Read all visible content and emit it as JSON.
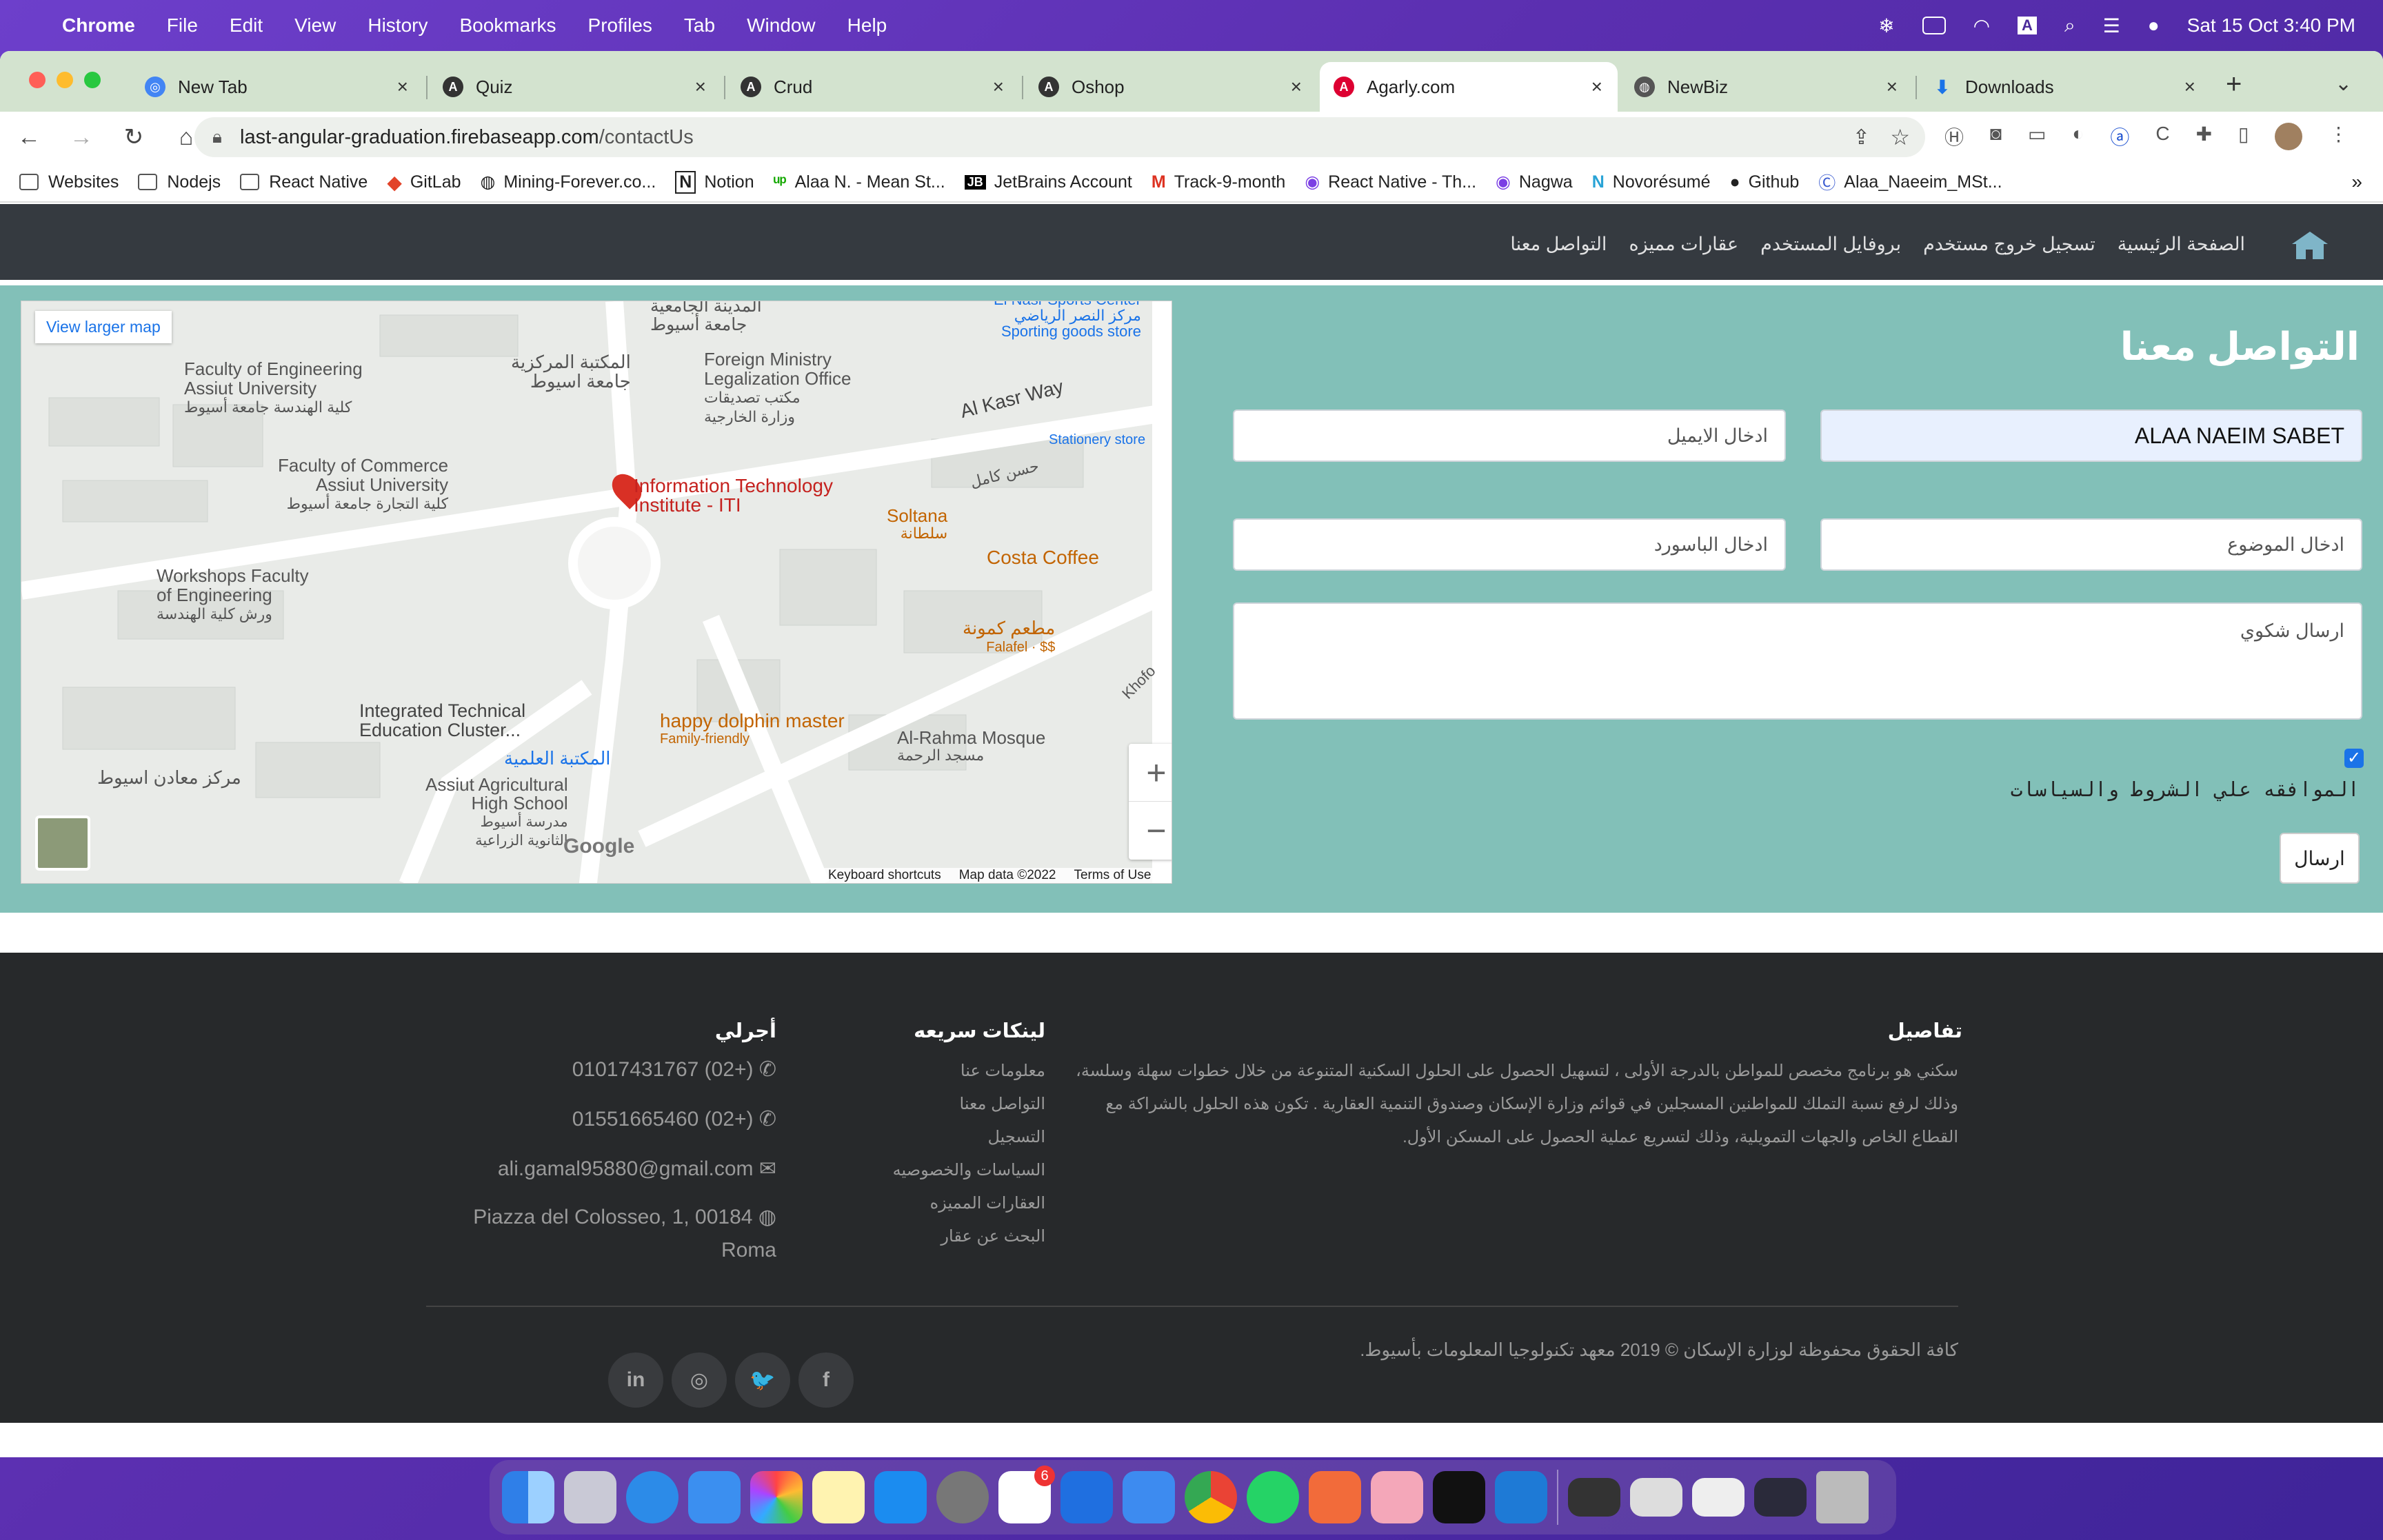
{
  "menubar": {
    "app": "Chrome",
    "items": [
      "File",
      "Edit",
      "View",
      "History",
      "Bookmarks",
      "Profiles",
      "Tab",
      "Window",
      "Help"
    ],
    "datetime": "Sat 15 Oct  3:40 PM",
    "icons": [
      "camera-status-icon",
      "battery-icon",
      "wifi-icon",
      "input-source-icon",
      "search-icon",
      "control-center-icon",
      "siri-icon"
    ]
  },
  "tabs": [
    {
      "label": "New Tab",
      "icon": "chrome-icon"
    },
    {
      "label": "Quiz",
      "icon": "angular-icon"
    },
    {
      "label": "Crud",
      "icon": "angular-icon"
    },
    {
      "label": "Oshop",
      "icon": "angular-icon"
    },
    {
      "label": "Agarly.com",
      "icon": "angular-red-icon",
      "active": true
    },
    {
      "label": "NewBiz",
      "icon": "globe-icon"
    },
    {
      "label": "Downloads",
      "icon": "download-icon"
    }
  ],
  "url": {
    "host": "last-angular-graduation.firebaseapp.com",
    "path": "/contactUs"
  },
  "bookmarks": [
    "Websites",
    "Nodejs",
    "React Native",
    "GitLab",
    "Mining-Forever.co...",
    "Notion",
    "Alaa N. - Mean St...",
    "JetBrains Account",
    "Track-9-month",
    "React Native - Th...",
    "Nagwa",
    "Novorésumé",
    "Github",
    "Alaa_Naeeim_MSt..."
  ],
  "nav": {
    "links": [
      "الصفحة الرئيسية",
      "تسجيل خروج مستخدم",
      "بروفايل المستخدم",
      "عقارات مميزه",
      "التواصل معنا"
    ]
  },
  "map": {
    "view_larger": "View larger map",
    "labels": [
      "Faculty of Engineering",
      "Assiut University",
      "كلية الهندسة جامعة أسيوط",
      "المكتبة المركزية",
      "جامعة اسيوط",
      "المدينة الجامعية",
      "جامعة أسيوط",
      "Foreign Ministry",
      "Legalization Office",
      "مكتب تصديقات",
      "وزارة الخارجية",
      "El Nasr Sports Center",
      "مركز النصر الرياضي",
      "Sporting goods store",
      "Al Kasr Way",
      "Stationery store",
      "Faculty of Commerce",
      "Assiut University",
      "كلية التجارة جامعة أسيوط",
      "Information Technology",
      "Institute - ITI",
      "Soltana",
      "سلطانة",
      "Costa Coffee",
      "Workshops Faculty",
      "of Engineering",
      "ورش كلية الهندسة",
      "مطعم كمونة",
      "Falafel · $$",
      "Khofo",
      "Integrated Technical",
      "Education Cluster...",
      "happy dolphin master",
      "Family-friendly",
      "Al-Rahma Mosque",
      "مسجد الرحمة",
      "مركز معادن اسيوط",
      "المكتبة العلمية",
      "Assiut Agricultural",
      "High School",
      "مدرسة أسيوط",
      "الثانوية الزراعية",
      "Google",
      "Keyboard shortcuts",
      "Map data ©2022",
      "Terms of Use",
      "حسن كامل"
    ],
    "zoom_in": "+",
    "zoom_out": "−"
  },
  "form": {
    "title": "التواصل معنا",
    "name_value": "ALAA NAEIM SABET",
    "email_placeholder": "ادخال الايميل",
    "subject_placeholder": "ادخال الموضوع",
    "password_placeholder": "ادخال الباسورد",
    "message_placeholder": "ارسال شكوي",
    "agree_label": "الموافقه علي الشروط والسياسات",
    "agree_checked": true,
    "submit": "ارسال"
  },
  "footer": {
    "details_title": "تفاصيل",
    "details_text": "سكني هو برنامج مخصص للمواطن بالدرجة الأولى ، لتسهيل الحصول على الحلول السكنية المتنوعة من خلال خطوات سهلة وسلسة، وذلك لرفع نسبة التملك للمواطنين المسجلين في قوائم وزارة الإسكان وصندوق التنمية العقارية . تكون هذه الحلول بالشراكة مع القطاع الخاص والجهات التمويلية، وذلك لتسريع عملية الحصول على المسكن الأول.",
    "links_title": "لينكات سريعه",
    "links": [
      "معلومات عنا",
      "التواصل معنا",
      "التسجيل",
      "السياسات والخصوصيه",
      "العقارات المميزه",
      "البحث عن عقار"
    ],
    "contact_title": "أجرلي",
    "phone1": "01017431767 (02+)",
    "phone2": "01551665460 (02+)",
    "email": "ali.gamal95880@gmail.com",
    "address1": "Piazza del Colosseo, 1, 00184",
    "address2": "Roma",
    "copyright": "كافة الحقوق محفوظة لوزارة الإسكان © 2019 معهد تكنولوجيا المعلومات بأسيوط.",
    "social": [
      {
        "name": "linkedin-icon",
        "glyph": "in"
      },
      {
        "name": "dribbble-icon",
        "glyph": "◎"
      },
      {
        "name": "twitter-icon",
        "glyph": "🐦"
      },
      {
        "name": "facebook-icon",
        "glyph": "f"
      }
    ]
  },
  "dock": [
    "finder-icon",
    "launchpad-icon",
    "safari-icon",
    "mail-icon",
    "photos-icon",
    "notes-icon",
    "app-store-icon",
    "system-preferences-icon",
    "slack-icon",
    "xcode-icon",
    "simulator-icon",
    "chrome-icon",
    "whatsapp-icon",
    "sketch-icon",
    "figma-icon",
    "terminal-icon",
    "vscode-icon",
    "window-preview-1",
    "window-preview-2",
    "window-preview-3",
    "window-preview-4",
    "trash-icon"
  ],
  "dock_badge": "6"
}
